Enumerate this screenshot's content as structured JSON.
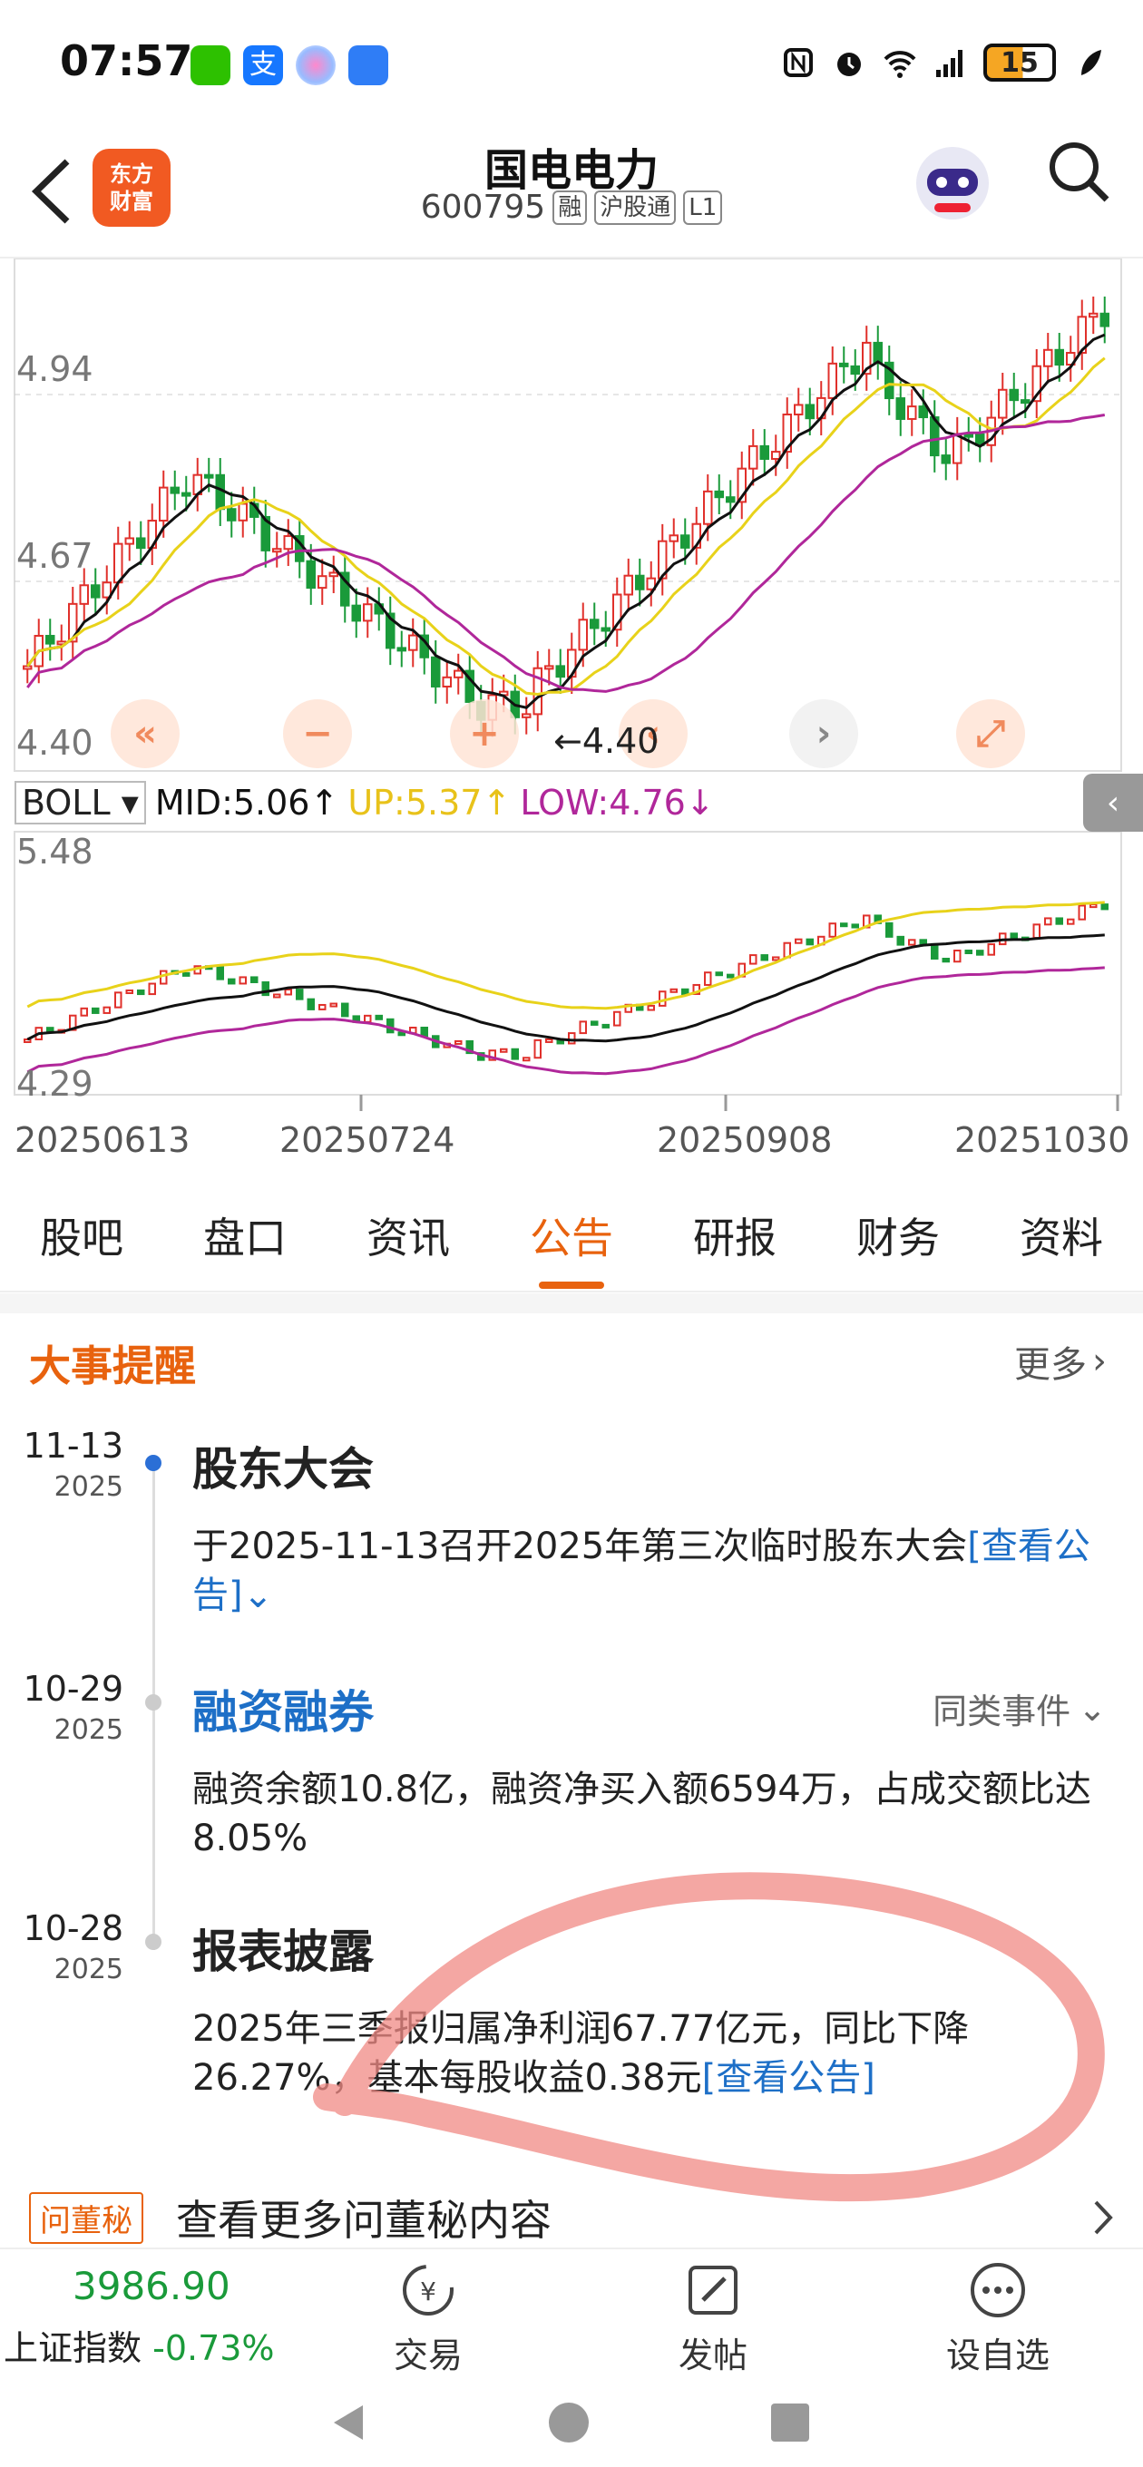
{
  "status": {
    "time": "07:57",
    "battery": "15"
  },
  "header": {
    "stock_name": "国电电力",
    "code": "600795",
    "tags": [
      "融",
      "沪股通",
      "L1"
    ],
    "brand_line1": "东方",
    "brand_line2": "财富"
  },
  "kline": {
    "price_labels": [
      "4.94",
      "4.67",
      "4.40"
    ],
    "low_marker": "4.40",
    "indicator": {
      "name": "BOLL",
      "mid": "MID:5.06",
      "up": "UP:5.37",
      "low": "LOW:4.76"
    },
    "boll_price_labels": [
      "5.48",
      "4.29"
    ],
    "dates": [
      "20250613",
      "20250724",
      "20250908",
      "20251030"
    ]
  },
  "colors": {
    "up": "#e0302b",
    "down": "#1a9a3a",
    "ma5": "#111111",
    "ma10": "#e8d21a",
    "ma20": "#b0279a",
    "accent": "#e8620e",
    "link": "#1d6fc7"
  },
  "tabs": [
    {
      "label": "股吧",
      "active": false
    },
    {
      "label": "盘口",
      "active": false
    },
    {
      "label": "资讯",
      "active": false
    },
    {
      "label": "公告",
      "active": true
    },
    {
      "label": "研报",
      "active": false
    },
    {
      "label": "财务",
      "active": false
    },
    {
      "label": "资料",
      "active": false
    }
  ],
  "events": {
    "title": "大事提醒",
    "more": "更多",
    "items": [
      {
        "date": "11-13",
        "year": "2025",
        "title": "股东大会",
        "body": "于2025-11-13召开2025年第三次临时股东大会",
        "link": "[查看公告]"
      },
      {
        "date": "10-29",
        "year": "2025",
        "title": "融资融券",
        "same_type": "同类事件",
        "body": "融资余额10.8亿，融资净买入额6594万，占成交额比达8.05%"
      },
      {
        "date": "10-28",
        "year": "2025",
        "title": "报表披露",
        "body": "2025年三季报归属净利润67.77亿元，同比下降26.27%，基本每股收益0.38元",
        "link": "[查看公告]"
      }
    ]
  },
  "secretary": {
    "badge": "问董秘",
    "text": "查看更多问董秘内容"
  },
  "bottom": {
    "index_value": "3986.90",
    "index_name": "上证指数",
    "index_change": "-0.73%",
    "trade": "交易",
    "post": "发帖",
    "watch": "设自选"
  }
}
